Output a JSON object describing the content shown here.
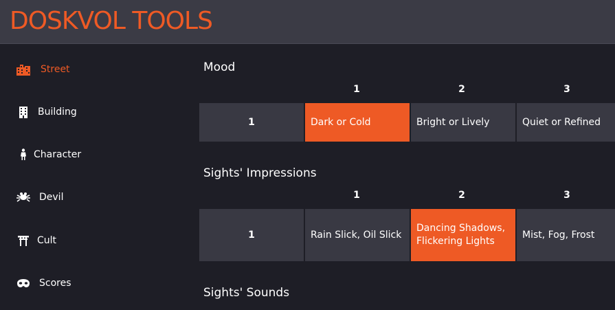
{
  "app": {
    "title": "DOSKVOL TOOLS"
  },
  "sidebar": {
    "items": [
      {
        "label": "Street",
        "icon": "city-icon",
        "active": true
      },
      {
        "label": "Building",
        "icon": "building-icon",
        "active": false
      },
      {
        "label": "Character",
        "icon": "person-icon",
        "active": false
      },
      {
        "label": "Devil",
        "icon": "spider-devil-icon",
        "active": false
      },
      {
        "label": "Cult",
        "icon": "torii-gate-icon",
        "active": false
      },
      {
        "label": "Scores",
        "icon": "mask-icon",
        "active": false
      }
    ]
  },
  "main": {
    "sections": [
      {
        "title": "Mood",
        "columns": [
          "1",
          "2",
          "3"
        ],
        "row_roll": "1",
        "cells": [
          "Dark or Cold",
          "Bright or Lively",
          "Quiet or Refined"
        ],
        "selected_index": 0
      },
      {
        "title": "Sights' Impressions",
        "columns": [
          "1",
          "2",
          "3"
        ],
        "row_roll": "1",
        "cells": [
          "Rain Slick, Oil Slick",
          "Dancing Shadows, Flickering Lights",
          "Mist, Fog, Frost"
        ],
        "selected_index": 1
      },
      {
        "title": "Sights' Sounds"
      }
    ]
  },
  "colors": {
    "accent": "#ee5a25",
    "background": "#1e1e26",
    "header": "#3b3b45",
    "cell": "#393943"
  }
}
